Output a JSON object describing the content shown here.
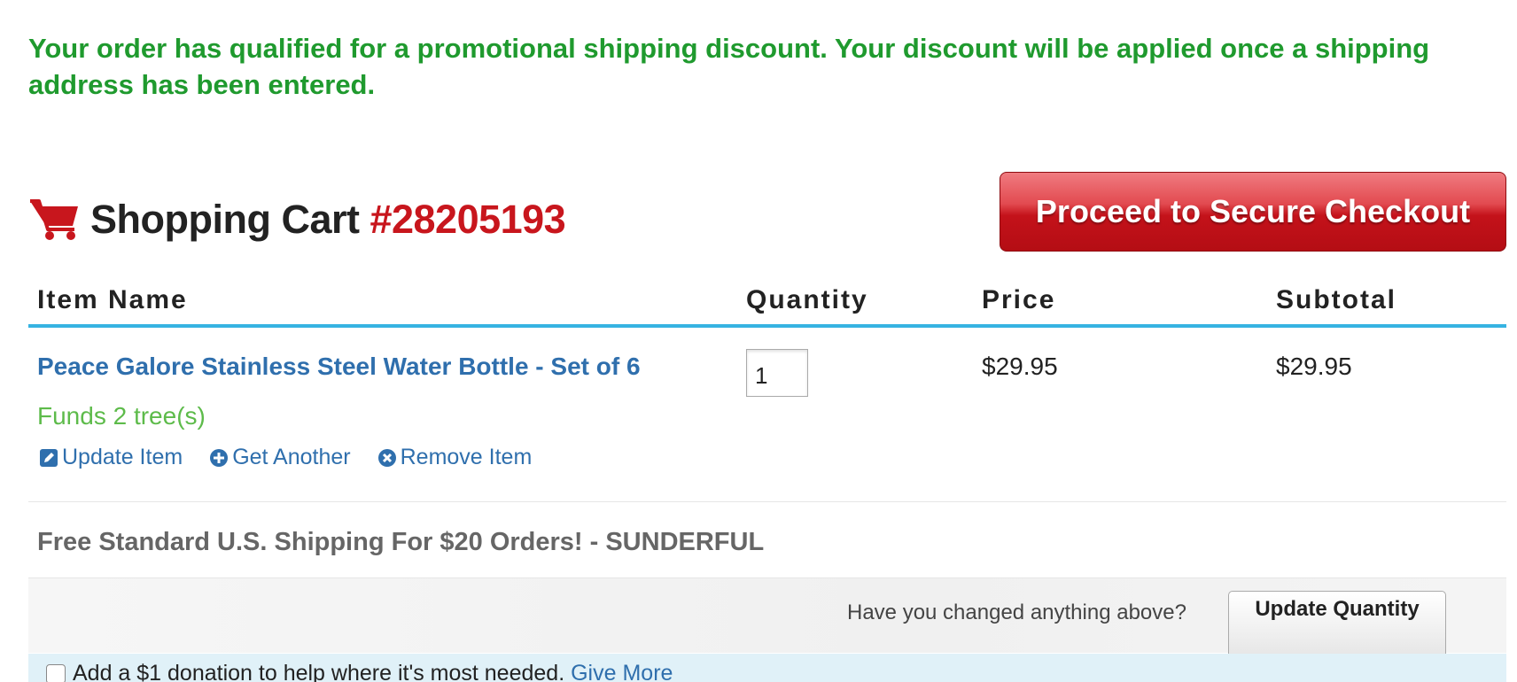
{
  "promo": {
    "message": "Your order has qualified for a promotional shipping discount. Your discount will be applied once a shipping address has been entered."
  },
  "cart": {
    "title": "Shopping Cart",
    "number": "#28205193",
    "icon": "shopping-cart-icon"
  },
  "checkout": {
    "label": "Proceed to Secure Checkout"
  },
  "table": {
    "headers": [
      "Item Name",
      "Quantity",
      "Price",
      "Subtotal"
    ]
  },
  "item": {
    "name": "Peace Galore Stainless Steel Water Bottle - Set of 6",
    "quantity": "1",
    "price": "$29.95",
    "subtotal": "$29.95",
    "funds": "Funds 2 tree(s)",
    "actions": {
      "update": "Update Item",
      "another": "Get Another",
      "remove": "Remove Item"
    }
  },
  "shipping": {
    "note": "Free Standard U.S. Shipping For $20 Orders! - SUNDERFUL"
  },
  "update": {
    "question": "Have you changed anything above?",
    "button": "Update Quantity"
  },
  "donation": {
    "text": "Add a $1 donation to help where it's most needed.",
    "link": "Give More"
  },
  "colors": {
    "promo_green": "#1f9a2e",
    "brand_red": "#c8161d",
    "link_blue": "#2f6fad",
    "header_rule": "#36b3e2",
    "funds_green": "#5dbb4a"
  }
}
